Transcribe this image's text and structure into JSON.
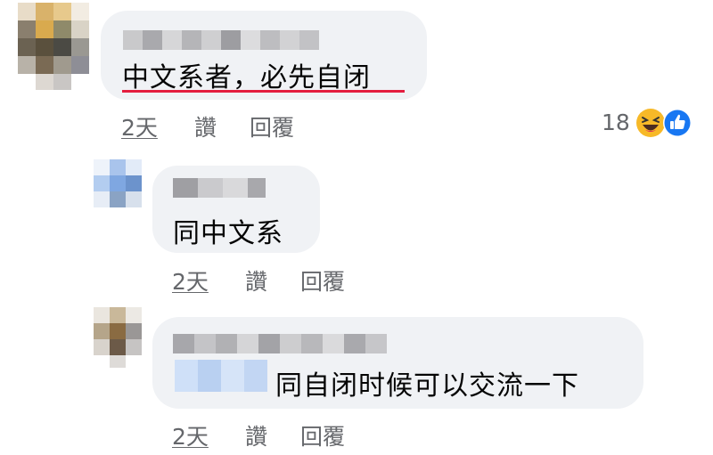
{
  "comments": [
    {
      "text": "中文系者，必先自闭",
      "actions": {
        "time": "2天",
        "like": "讚",
        "reply": "回覆"
      },
      "reaction_count": "18",
      "reactions": [
        "haha-icon",
        "like-icon"
      ]
    },
    {
      "text": "同中文系",
      "actions": {
        "time": "2天",
        "like": "讚",
        "reply": "回覆"
      }
    },
    {
      "text": "同自闭时候可以交流一下",
      "actions": {
        "time": "2天",
        "like": "讚",
        "reply": "回覆"
      }
    }
  ],
  "colors": {
    "bubble": "#f0f2f5",
    "secondary_text": "#65676b",
    "underline": "#e41e3f",
    "like_blue": "#1877f2",
    "haha_yellow": "#f7b928"
  }
}
